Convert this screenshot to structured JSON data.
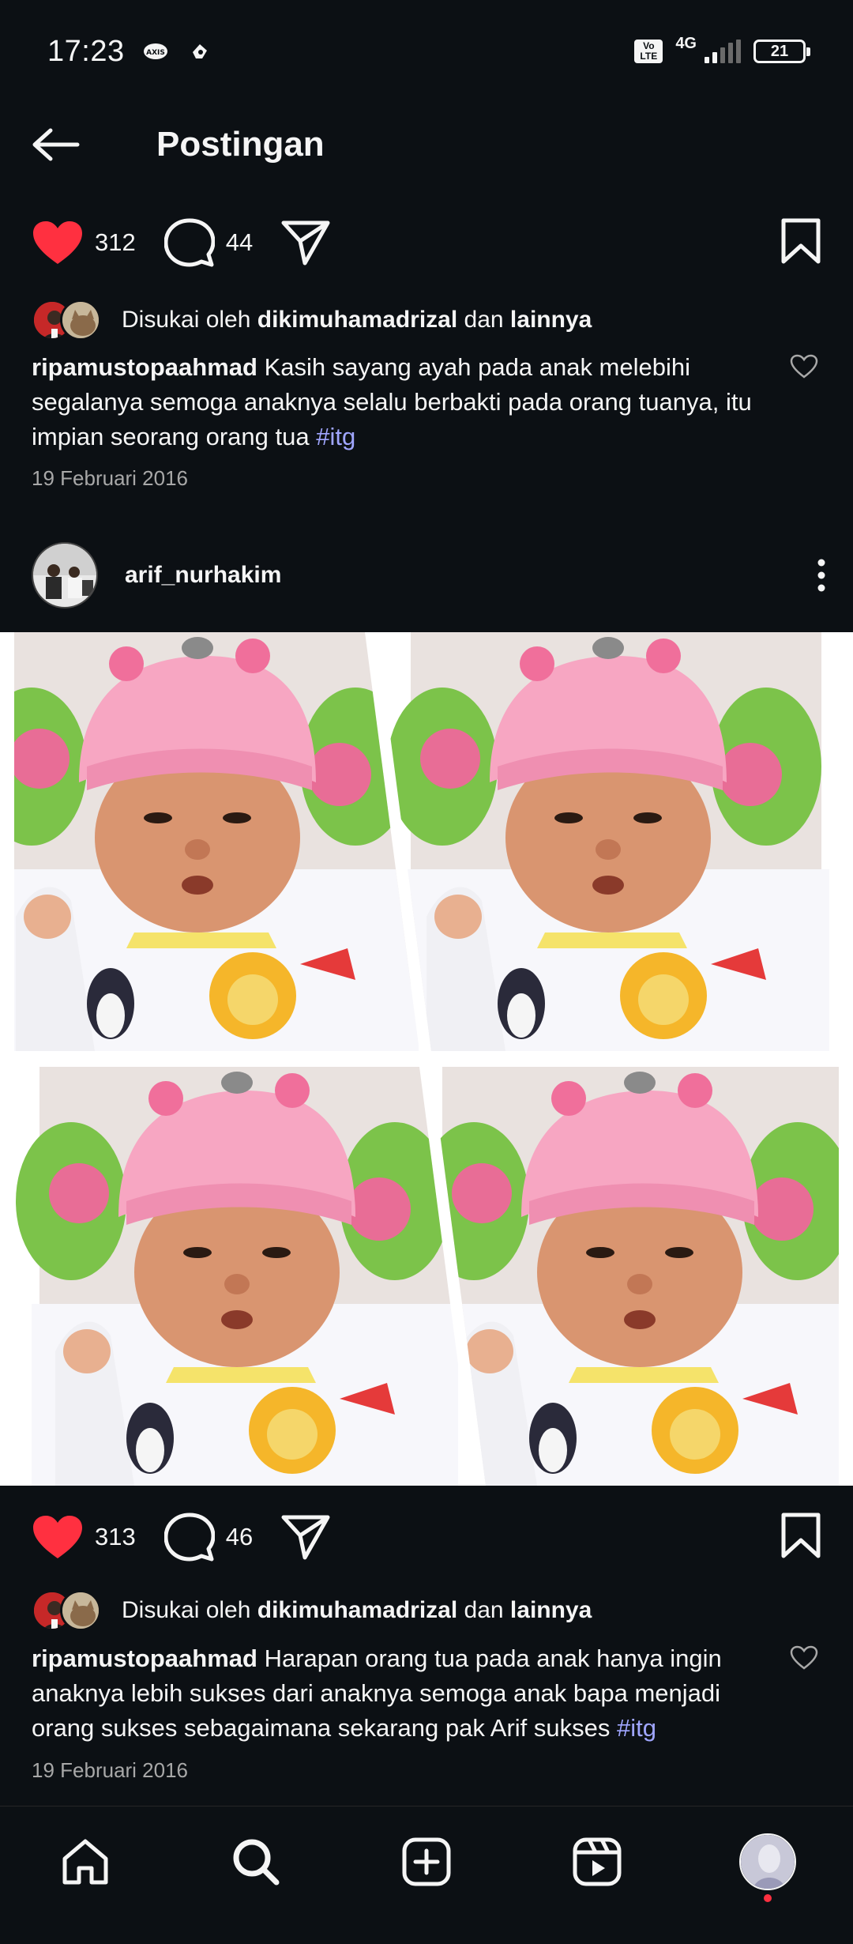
{
  "status_bar": {
    "time": "17:23",
    "network": "4G",
    "volte": "Vo LTE",
    "battery": "21"
  },
  "header": {
    "title": "Postingan"
  },
  "post1": {
    "likes": "312",
    "comments": "44",
    "liked_prefix": "Disukai oleh",
    "liked_user": "dikimuhamadrizal",
    "liked_and": "dan",
    "liked_others": "lainnya",
    "caption_user": "ripamustopaahmad",
    "caption_text": "Kasih sayang ayah pada anak melebihi segalanya semoga anaknya selalu berbakti pada orang tuanya, itu impian seorang orang tua",
    "hashtag": "#itg",
    "date": "19 Februari 2016"
  },
  "post2": {
    "author": "arif_nurhakim",
    "likes": "313",
    "comments": "46",
    "liked_prefix": "Disukai oleh",
    "liked_user": "dikimuhamadrizal",
    "liked_and": "dan",
    "liked_others": "lainnya",
    "caption_user": "ripamustopaahmad",
    "caption_text": "Harapan orang tua pada anak hanya ingin anaknya lebih sukses dari anaknya semoga anak bapa menjadi orang sukses sebagaimana sekarang pak Arif sukses",
    "hashtag": "#itg",
    "date": "19 Februari 2016"
  },
  "icons": {
    "like": "heart-filled-icon",
    "comment": "comment-icon",
    "share": "send-icon",
    "save": "bookmark-icon",
    "nav": [
      "home-icon",
      "search-icon",
      "create-icon",
      "reels-icon",
      "profile-avatar"
    ]
  },
  "colors": {
    "background": "#0c1014",
    "like_red": "#ff3040",
    "hashtag": "#a0a6ff",
    "muted": "#a8a8a8"
  }
}
